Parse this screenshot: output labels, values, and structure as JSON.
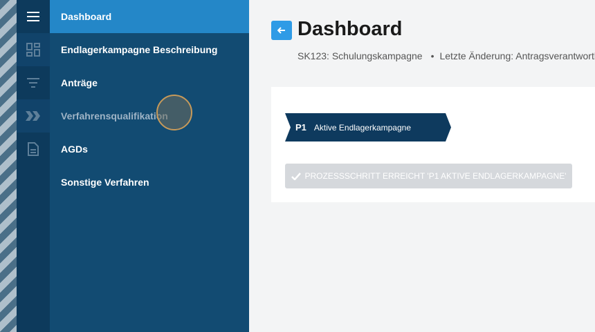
{
  "sidebar": {
    "items": [
      {
        "label": "Dashboard"
      },
      {
        "label": "Endlagerkampagne Beschreibung"
      },
      {
        "label": "Anträge"
      },
      {
        "label": "Verfahrensqualifikation"
      },
      {
        "label": "AGDs"
      },
      {
        "label": "Sonstige Verfahren"
      }
    ]
  },
  "rail": {
    "icons": [
      "menu-icon",
      "dashboard-icon",
      "filter-list-icon",
      "double-chevron-icon",
      "document-icon"
    ]
  },
  "header": {
    "title": "Dashboard",
    "subtitle_campaign": "SK123: Schulungskampagne",
    "subtitle_separator": "•",
    "subtitle_change": "Letzte Änderung: Antragsverantwortlich"
  },
  "process": {
    "step_number": "P1",
    "step_label": "Aktive Endlagerkampagne",
    "reached_button": "PROZESSSCHRITT ERREICHT 'P1 AKTIVE ENDLAGERKAMPAGNE'"
  },
  "colors": {
    "accent": "#2487c8",
    "sidebar": "#124b72",
    "rail": "#0d3a5c",
    "step": "#0e3a5e"
  }
}
